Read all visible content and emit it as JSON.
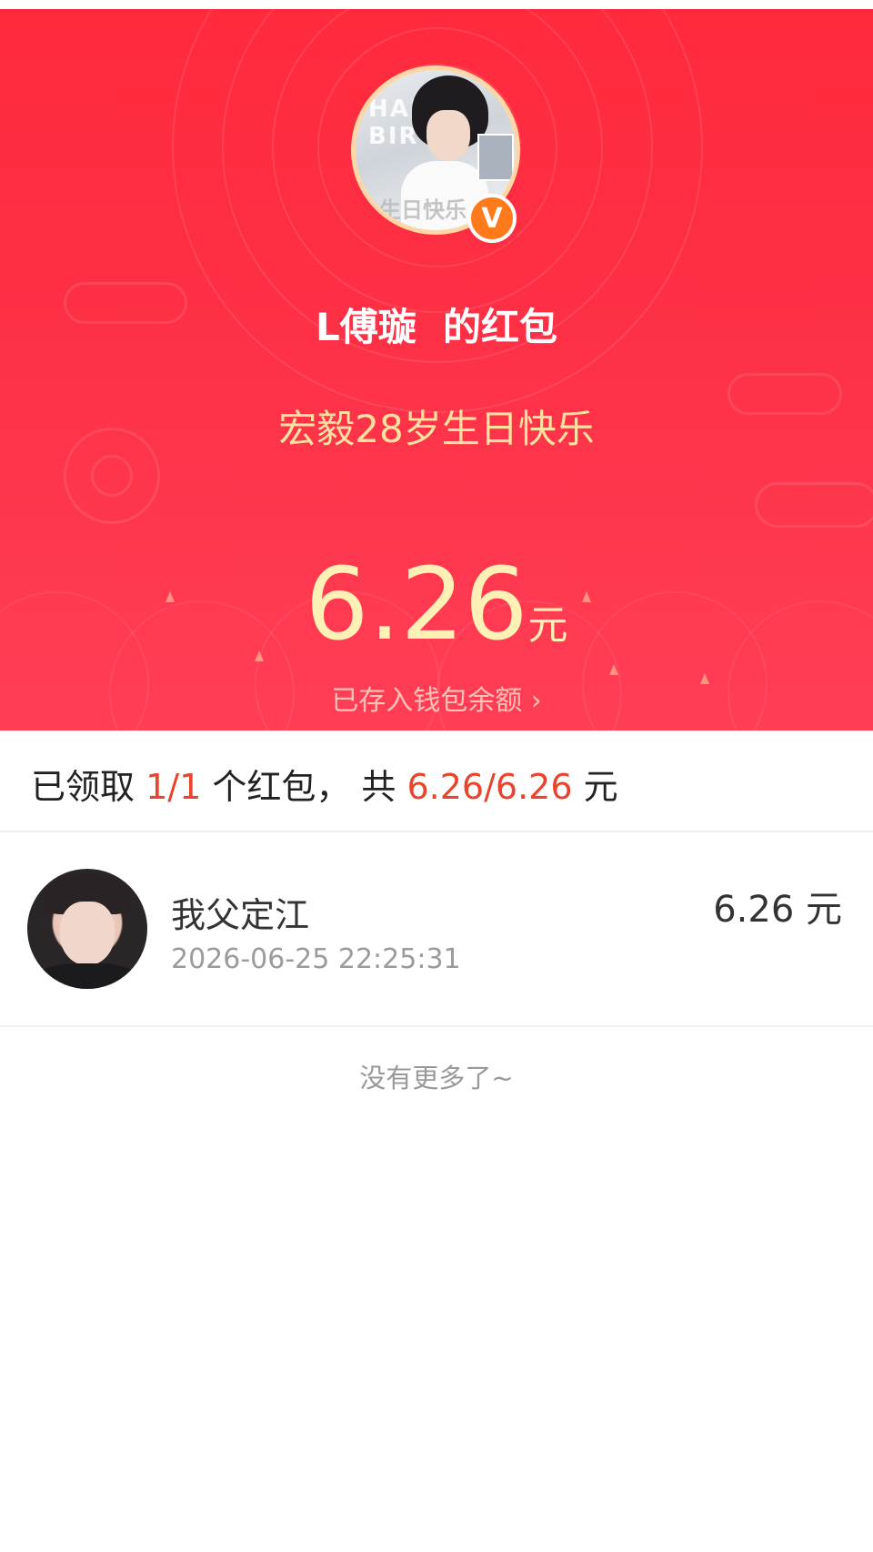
{
  "hero": {
    "sender_name": "L傅璇  的红包",
    "greeting": "宏毅28岁生日快乐",
    "amount": "6.26",
    "amount_unit": "元",
    "wallet_link": "已存入钱包余额 ›",
    "avatar": {
      "letters": "HAPPY BIR",
      "caption": "生日快乐",
      "verified_badge": "V"
    },
    "colors": {
      "gradient_top": "#ff2a3c",
      "gradient_bottom": "#ff3e56",
      "amount": "#fff0b5",
      "greeting": "#ffe2a0"
    }
  },
  "summary": {
    "prefix": "已领取 ",
    "claimed": "1/1",
    "middle": " 个红包， 共 ",
    "total": "6.26/6.26",
    "suffix": " 元",
    "highlight_color": "#e8452e"
  },
  "recipients": [
    {
      "name": "我父定江",
      "time": "2026-06-25 22:25:31",
      "amount": "6.26 元"
    }
  ],
  "footer": {
    "no_more": "没有更多了~"
  }
}
